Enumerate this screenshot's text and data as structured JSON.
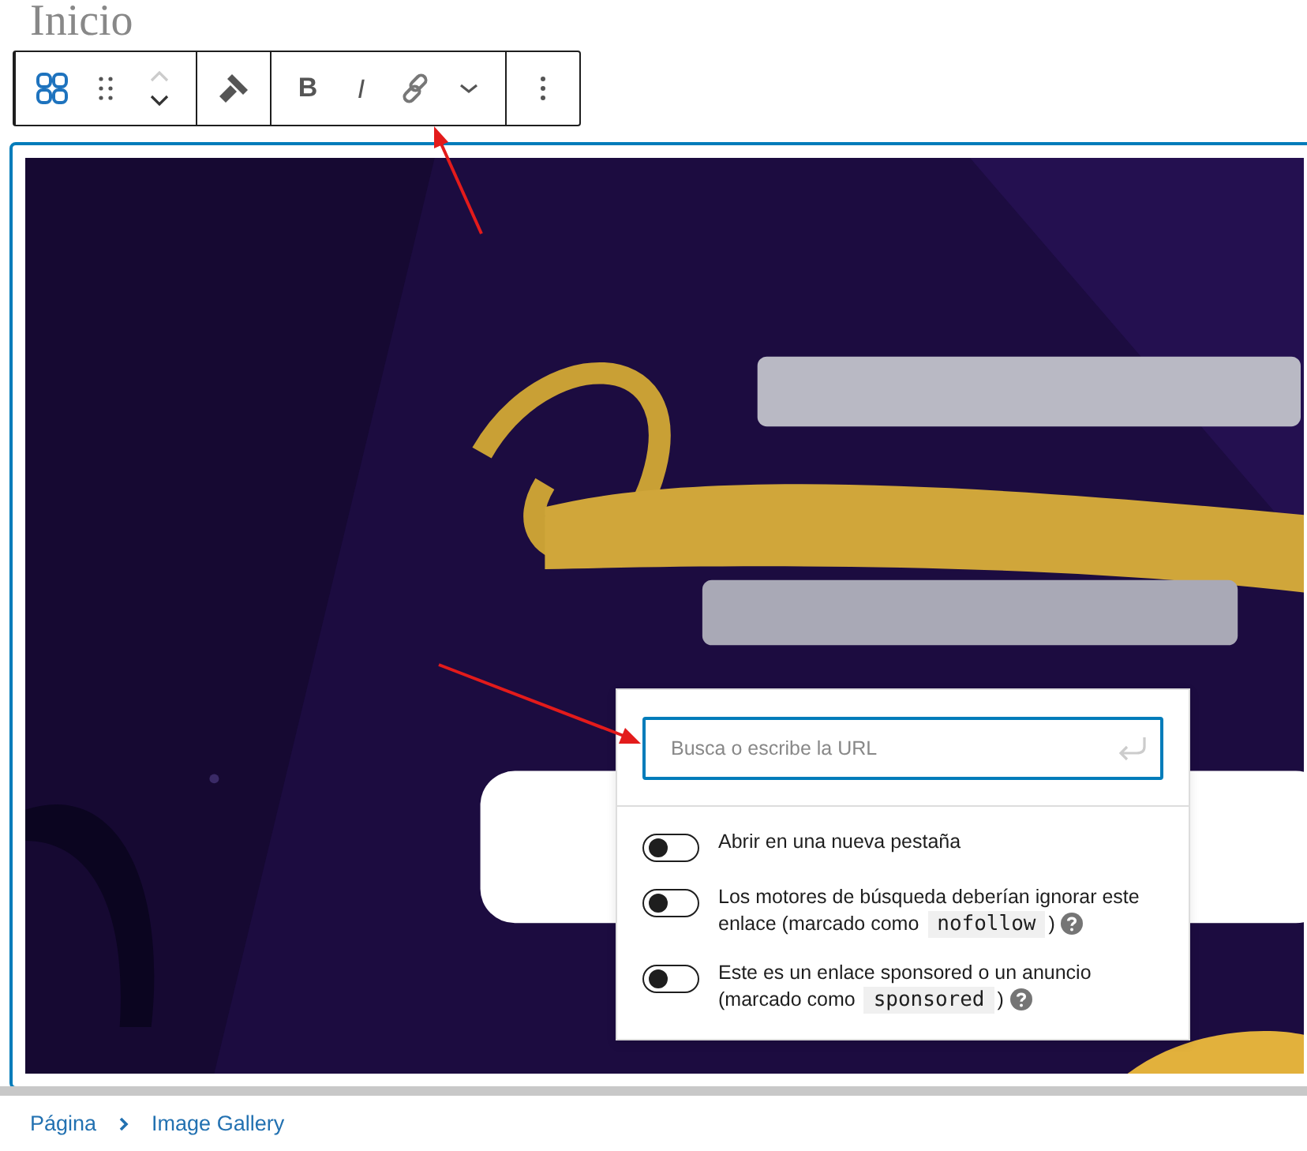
{
  "page_title": "Inicio",
  "toolbar": {
    "groups": [
      {
        "buttons": [
          {
            "kind": "block-type"
          },
          {
            "kind": "drag"
          },
          {
            "kind": "mover"
          }
        ]
      },
      {
        "buttons": [
          {
            "kind": "brush"
          }
        ]
      },
      {
        "buttons": [
          {
            "kind": "bold",
            "label": "B"
          },
          {
            "kind": "italic",
            "label": "I"
          },
          {
            "kind": "link"
          },
          {
            "kind": "chevron"
          }
        ]
      },
      {
        "buttons": [
          {
            "kind": "more"
          }
        ]
      }
    ]
  },
  "image_block": {
    "kind": "picture",
    "selected": true
  },
  "link_popover": {
    "url_field": {
      "placeholder": "Busca o escribe la URL"
    },
    "options": [
      {
        "on": false,
        "text": "Abrir en una nueva pestaña",
        "help": false
      },
      {
        "on": false,
        "text": "Los motores de búsqueda deberían ignorar este enlace (marcado como ",
        "code": "nofollow",
        "after": ")",
        "help": true
      },
      {
        "on": false,
        "text": "Este es un enlace sponsored o un anuncio (marcado como ",
        "code": "sponsored",
        "after": ")",
        "help": true
      }
    ]
  },
  "breadcrumb": [
    "Página",
    "Image Gallery"
  ]
}
